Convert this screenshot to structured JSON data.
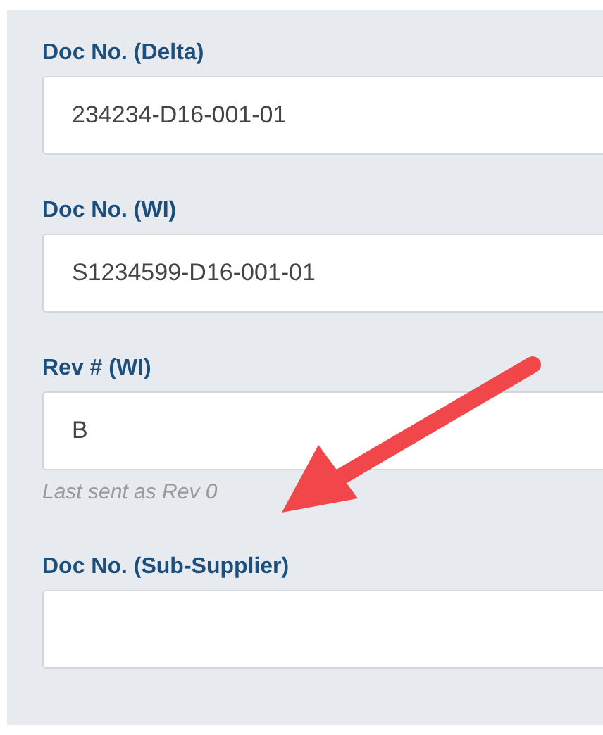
{
  "fields": [
    {
      "label": "Doc No. (Delta)",
      "value": "234234-D16-001-01"
    },
    {
      "label": "Doc No. (WI)",
      "value": "S1234599-D16-001-01"
    },
    {
      "label": "Rev # (WI)",
      "value": "B",
      "hint": "Last sent as Rev 0"
    },
    {
      "label": "Doc No. (Sub-Supplier)"
    }
  ]
}
